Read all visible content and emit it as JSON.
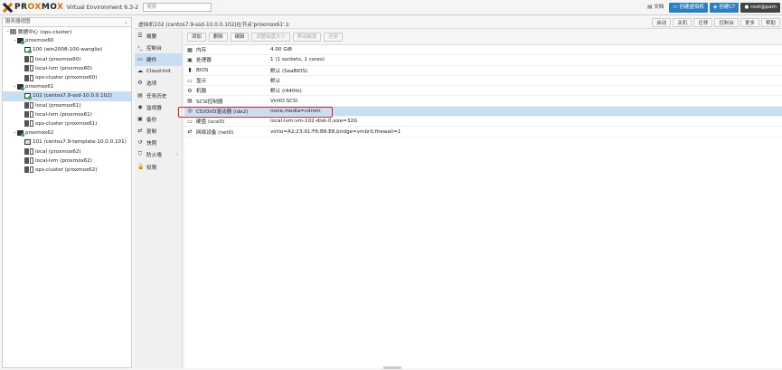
{
  "header": {
    "logo_pro": "PR",
    "logo_ox": "OX",
    "logo_mo": "MO",
    "logo_x": "X",
    "version": "Virtual Environment 6.3-2",
    "search_placeholder": "搜索",
    "buttons": {
      "docs": "文档",
      "create_vm": "创建虚拟机",
      "create_ct": "创建CT",
      "user": "root@pam",
      "help": "帮助"
    }
  },
  "tree": {
    "view": "服务器视图",
    "items": [
      {
        "label": "数据中心 (ops-cluster)",
        "type": "dc",
        "indent": 0
      },
      {
        "label": "proxmox60",
        "type": "node",
        "indent": 1
      },
      {
        "label": "100 (win2008-100-wanglie)",
        "type": "vm",
        "indent": 2
      },
      {
        "label": "local (proxmox60)",
        "type": "storage",
        "indent": 2
      },
      {
        "label": "local-lvm (proxmox60)",
        "type": "storage",
        "indent": 2
      },
      {
        "label": "ops-cluster (proxmox60)",
        "type": "storage",
        "indent": 2
      },
      {
        "label": "proxmox61",
        "type": "node",
        "indent": 1
      },
      {
        "label": "102 (centos7.9-ssd-10.0.0.102)",
        "type": "vm",
        "indent": 2,
        "selected": true
      },
      {
        "label": "local (proxmox61)",
        "type": "storage",
        "indent": 2
      },
      {
        "label": "local-lvm (proxmox61)",
        "type": "storage",
        "indent": 2
      },
      {
        "label": "ops-cluster (proxmox61)",
        "type": "storage",
        "indent": 2
      },
      {
        "label": "proxmox62",
        "type": "node",
        "indent": 1
      },
      {
        "label": "101 (centos7.9-template-10.0.0.101)",
        "type": "tpl",
        "indent": 2
      },
      {
        "label": "local (proxmox62)",
        "type": "storage",
        "indent": 2
      },
      {
        "label": "local-lvm (proxmox62)",
        "type": "storage",
        "indent": 2
      },
      {
        "label": "ops-cluster (proxmox62)",
        "type": "storage",
        "indent": 2
      }
    ]
  },
  "content": {
    "title": "虚拟机102 (centos7.9-ssd-10.0.0.102)在节点'proxmox61'上",
    "actions": [
      "启动",
      "关机",
      "迁移",
      "控制台",
      "更多",
      "帮助"
    ]
  },
  "menu": {
    "items": [
      {
        "label": "概要",
        "icon": "☰"
      },
      {
        "label": "控制台",
        "icon": "›_"
      },
      {
        "label": "硬件",
        "icon": "▭",
        "selected": true
      },
      {
        "label": "Cloud-Init",
        "icon": "☁"
      },
      {
        "label": "选项",
        "icon": "⚙"
      },
      {
        "label": "任务历史",
        "icon": "▤"
      },
      {
        "label": "监视器",
        "icon": "◉"
      },
      {
        "label": "备份",
        "icon": "▣"
      },
      {
        "label": "复制",
        "icon": "⇄"
      },
      {
        "label": "快照",
        "icon": "↺"
      },
      {
        "label": "防火墙",
        "icon": "⛉",
        "arrow": "›"
      },
      {
        "label": "权限",
        "icon": "🔓"
      }
    ]
  },
  "toolbar": {
    "add": "添加",
    "remove": "删除",
    "edit": "编辑",
    "resize": "调整磁盘大小",
    "move": "移动磁盘",
    "revert": "还原"
  },
  "hardware": {
    "rows": [
      {
        "key": "内存",
        "value": "4.00 GiB",
        "icon": "▦"
      },
      {
        "key": "处理器",
        "value": "1 (1 sockets, 1 cores)",
        "icon": "▣"
      },
      {
        "key": "BIOS",
        "value": "默认 (SeaBIOS)",
        "icon": "▮"
      },
      {
        "key": "显示",
        "value": "默认",
        "icon": "▭"
      },
      {
        "key": "机器",
        "value": "默认 (i440fx)",
        "icon": "⚙"
      },
      {
        "key": "SCSI控制器",
        "value": "VirtIO SCSI",
        "icon": "▤"
      },
      {
        "key": "CD/DVD驱动器 (ide2)",
        "value": "none,media=cdrom",
        "icon": "◎",
        "selected": true
      },
      {
        "key": "硬盘 (scsi0)",
        "value": "local-lvm:vm-102-disk-0,size=32G",
        "icon": "▭"
      },
      {
        "key": "网络设备 (net0)",
        "value": "virtio=A2:23:91:F6:B8:E8,bridge=vmbr0,firewall=1",
        "icon": "⇄"
      }
    ]
  }
}
